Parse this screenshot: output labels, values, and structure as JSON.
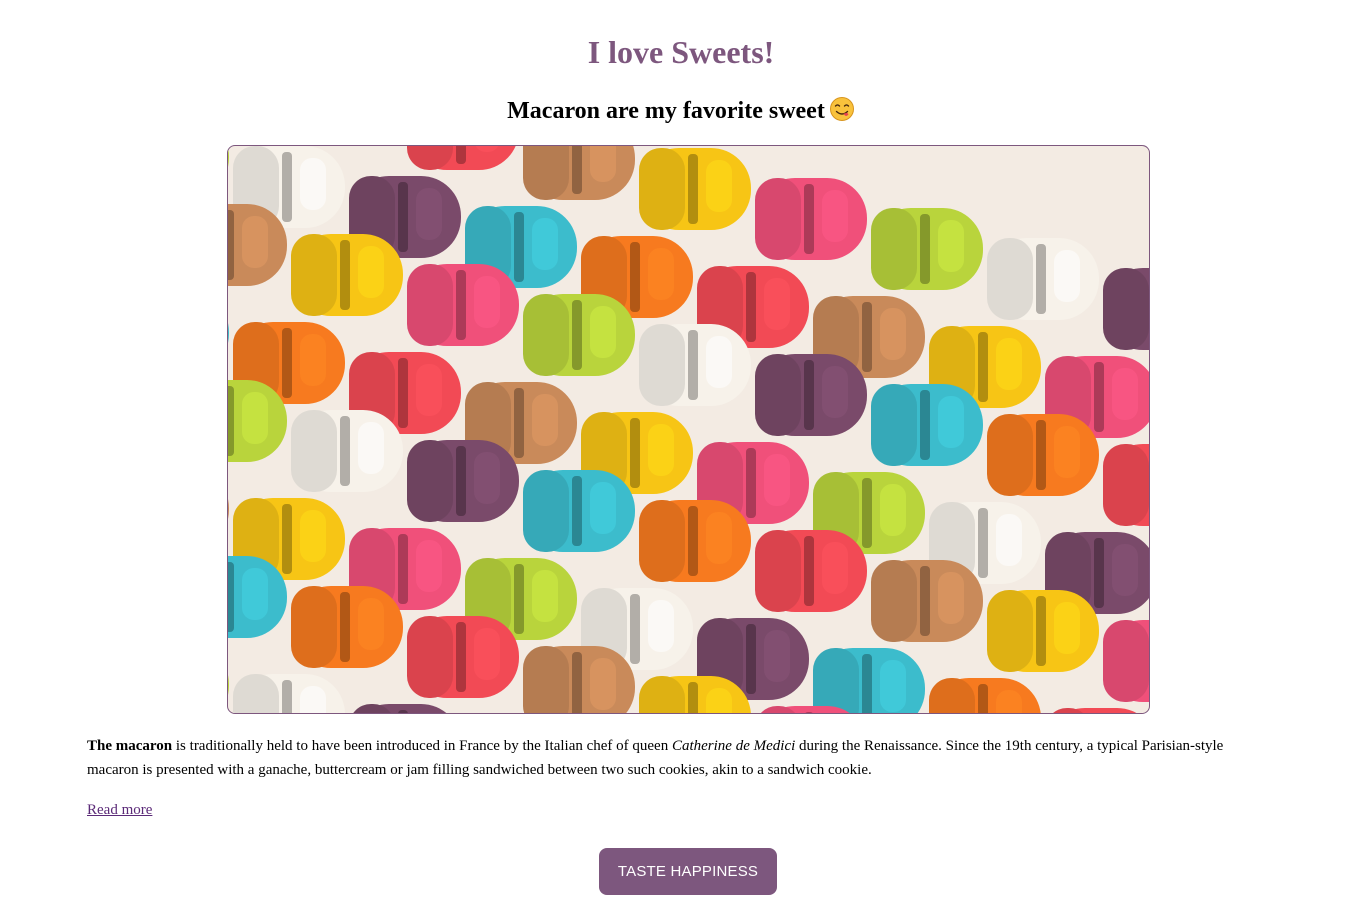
{
  "header": {
    "title": "I love Sweets!",
    "subtitle": "Macaron are my favorite sweet"
  },
  "icons": {
    "subtitle_emoji": "face-savoring-food-icon"
  },
  "image": {
    "subject": "macarons-photo"
  },
  "description": {
    "bold_lead": "The macaron",
    "text_part1": " is traditionally held to have been introduced in France by the Italian chef of queen ",
    "italic_name": "Catherine de Medici",
    "text_part2": " during the Renaissance. Since the 19th century, a typical Parisian-style macaron is presented with a ganache, buttercream or jam filling sandwiched between two such cookies, akin to a sandwich cookie."
  },
  "links": {
    "read_more": "Read more"
  },
  "cta": {
    "label": "TASTE HAPPINESS"
  },
  "colors": {
    "accent": "#7d577e",
    "link": "#5b2a78",
    "macaron_palette": [
      "#f0507a",
      "#f7f2ea",
      "#3cbccc",
      "#f24a55",
      "#f7c515",
      "#b9d43c",
      "#7a4a6a",
      "#f77a1f",
      "#c98a5a"
    ]
  }
}
